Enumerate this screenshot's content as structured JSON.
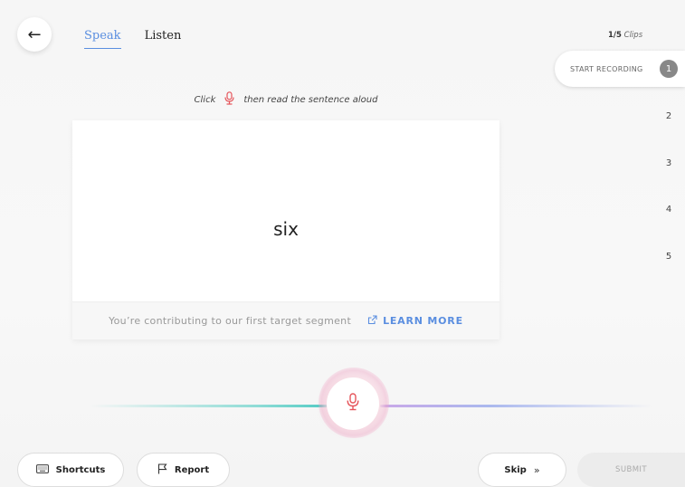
{
  "nav": {
    "back_icon": "arrow-left-icon",
    "tabs": [
      {
        "label": "Speak",
        "active": true
      },
      {
        "label": "Listen",
        "active": false
      }
    ]
  },
  "clips": {
    "current": "1/5",
    "suffix": "Clips"
  },
  "progress": {
    "start_label": "START RECORDING",
    "steps": [
      "1",
      "2",
      "3",
      "4",
      "5"
    ],
    "active_step": 1
  },
  "instruction": {
    "before": "Click",
    "after": "then read the sentence aloud",
    "icon": "microphone-icon"
  },
  "card": {
    "sentence": "six",
    "footer_text": "You’re contributing to our first target segment",
    "learn_more": "LEARN MORE"
  },
  "record": {
    "icon": "microphone-icon"
  },
  "footer": {
    "shortcuts": "Shortcuts",
    "report": "Report",
    "skip": "Skip",
    "submit": "SUBMIT"
  },
  "colors": {
    "accent": "#5a8ee0",
    "mic": "#e5545a"
  }
}
